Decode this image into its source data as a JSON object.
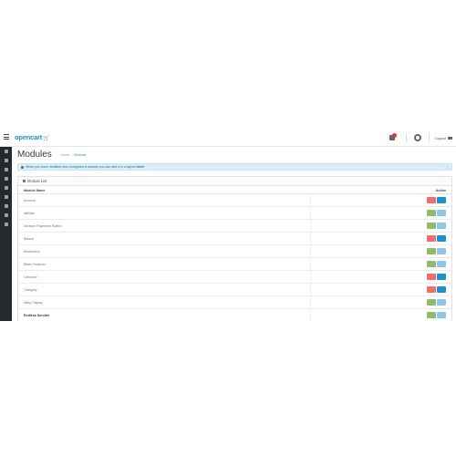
{
  "app": {
    "logo_main": "opencart",
    "logo_cart": "🛒",
    "logout_label": "Logout"
  },
  "page": {
    "title": "Modules",
    "breadcrumb": [
      "Home",
      "Modules"
    ]
  },
  "alert": {
    "text_prefix": "When you have installed and configured a module you can add it to a layout",
    "link_text": "here!",
    "close": "×"
  },
  "panel": {
    "title": "Module List",
    "columns": {
      "name": "Module Name",
      "action": "Action"
    }
  },
  "modules": [
    {
      "name": "Account",
      "state": "installable"
    },
    {
      "name": "Affiliate",
      "state": "installed"
    },
    {
      "name": "Amazon Payments Button",
      "state": "installed"
    },
    {
      "name": "Banner",
      "state": "installable"
    },
    {
      "name": "Bestsellers",
      "state": "installed"
    },
    {
      "name": "Blank Features",
      "state": "installed"
    },
    {
      "name": "Carousel",
      "state": "installable"
    },
    {
      "name": "Category",
      "state": "installable"
    },
    {
      "name": "eBay Display",
      "state": "installed"
    },
    {
      "name": "Endless Scroller",
      "state": "installed"
    }
  ],
  "colors": {
    "sidebar": "#222a2e",
    "accent": "#1e91cf",
    "danger": "#f56b6b",
    "success": "#8fbb6c",
    "alert_bg": "#d9edf7"
  },
  "icons": {
    "menu": "bars-icon",
    "bell": "bell-icon",
    "settings": "gear-icon",
    "logout": "sign-out-icon",
    "sidebar": [
      "dashboard-icon",
      "catalog-icon",
      "extensions-icon",
      "design-icon",
      "sales-icon",
      "customers-icon",
      "marketing-icon",
      "system-icon",
      "reports-icon"
    ]
  }
}
